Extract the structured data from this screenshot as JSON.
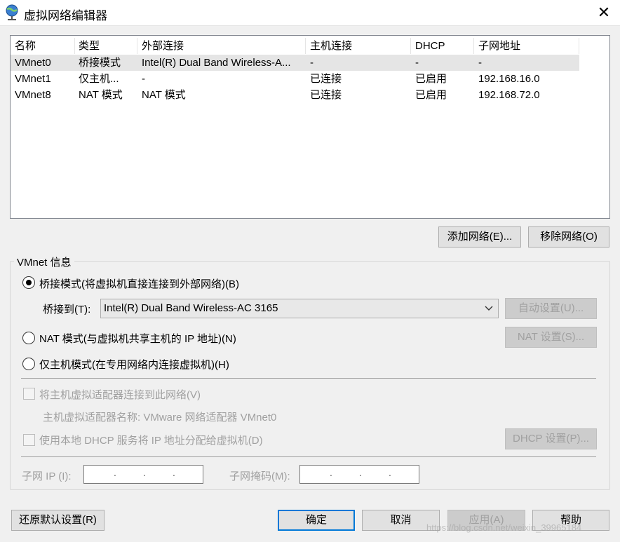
{
  "window": {
    "title": "虚拟网络编辑器",
    "close_glyph": "✕"
  },
  "table": {
    "headers": [
      "名称",
      "类型",
      "外部连接",
      "主机连接",
      "DHCP",
      "子网地址"
    ],
    "rows": [
      [
        "VMnet0",
        "桥接模式",
        "Intel(R) Dual Band Wireless-A...",
        "-",
        "-",
        "-"
      ],
      [
        "VMnet1",
        "仅主机...",
        "-",
        "已连接",
        "已启用",
        "192.168.16.0"
      ],
      [
        "VMnet8",
        "NAT 模式",
        "NAT 模式",
        "已连接",
        "已启用",
        "192.168.72.0"
      ]
    ],
    "selected_row": 0
  },
  "net_buttons": {
    "add": "添加网络(E)...",
    "remove": "移除网络(O)"
  },
  "vmnet_info": {
    "title": "VMnet 信息",
    "bridged_label": "桥接模式(将虚拟机直接连接到外部网络)(B)",
    "bridge_to_label": "桥接到(T):",
    "bridge_to_value": "Intel(R) Dual Band Wireless-AC 3165",
    "auto_settings": "自动设置(U)...",
    "nat_label": "NAT 模式(与虚拟机共享主机的 IP 地址)(N)",
    "nat_settings": "NAT 设置(S)...",
    "hostonly_label": "仅主机模式(在专用网络内连接虚拟机)(H)",
    "connect_adapter_label": "将主机虚拟适配器连接到此网络(V)",
    "adapter_name_label": "主机虚拟适配器名称: VMware 网络适配器 VMnet0",
    "dhcp_label": "使用本地 DHCP 服务将 IP 地址分配给虚拟机(D)",
    "dhcp_settings": "DHCP 设置(P)...",
    "subnet_ip_label": "子网 IP (I):",
    "subnet_mask_label": "子网掩码(M):",
    "selected_mode": "bridged"
  },
  "footer": {
    "restore": "还原默认设置(R)",
    "ok": "确定",
    "cancel": "取消",
    "apply": "应用(A)",
    "help": "帮助"
  },
  "watermark": "https://blog.csdn.net/weixin_39965184"
}
